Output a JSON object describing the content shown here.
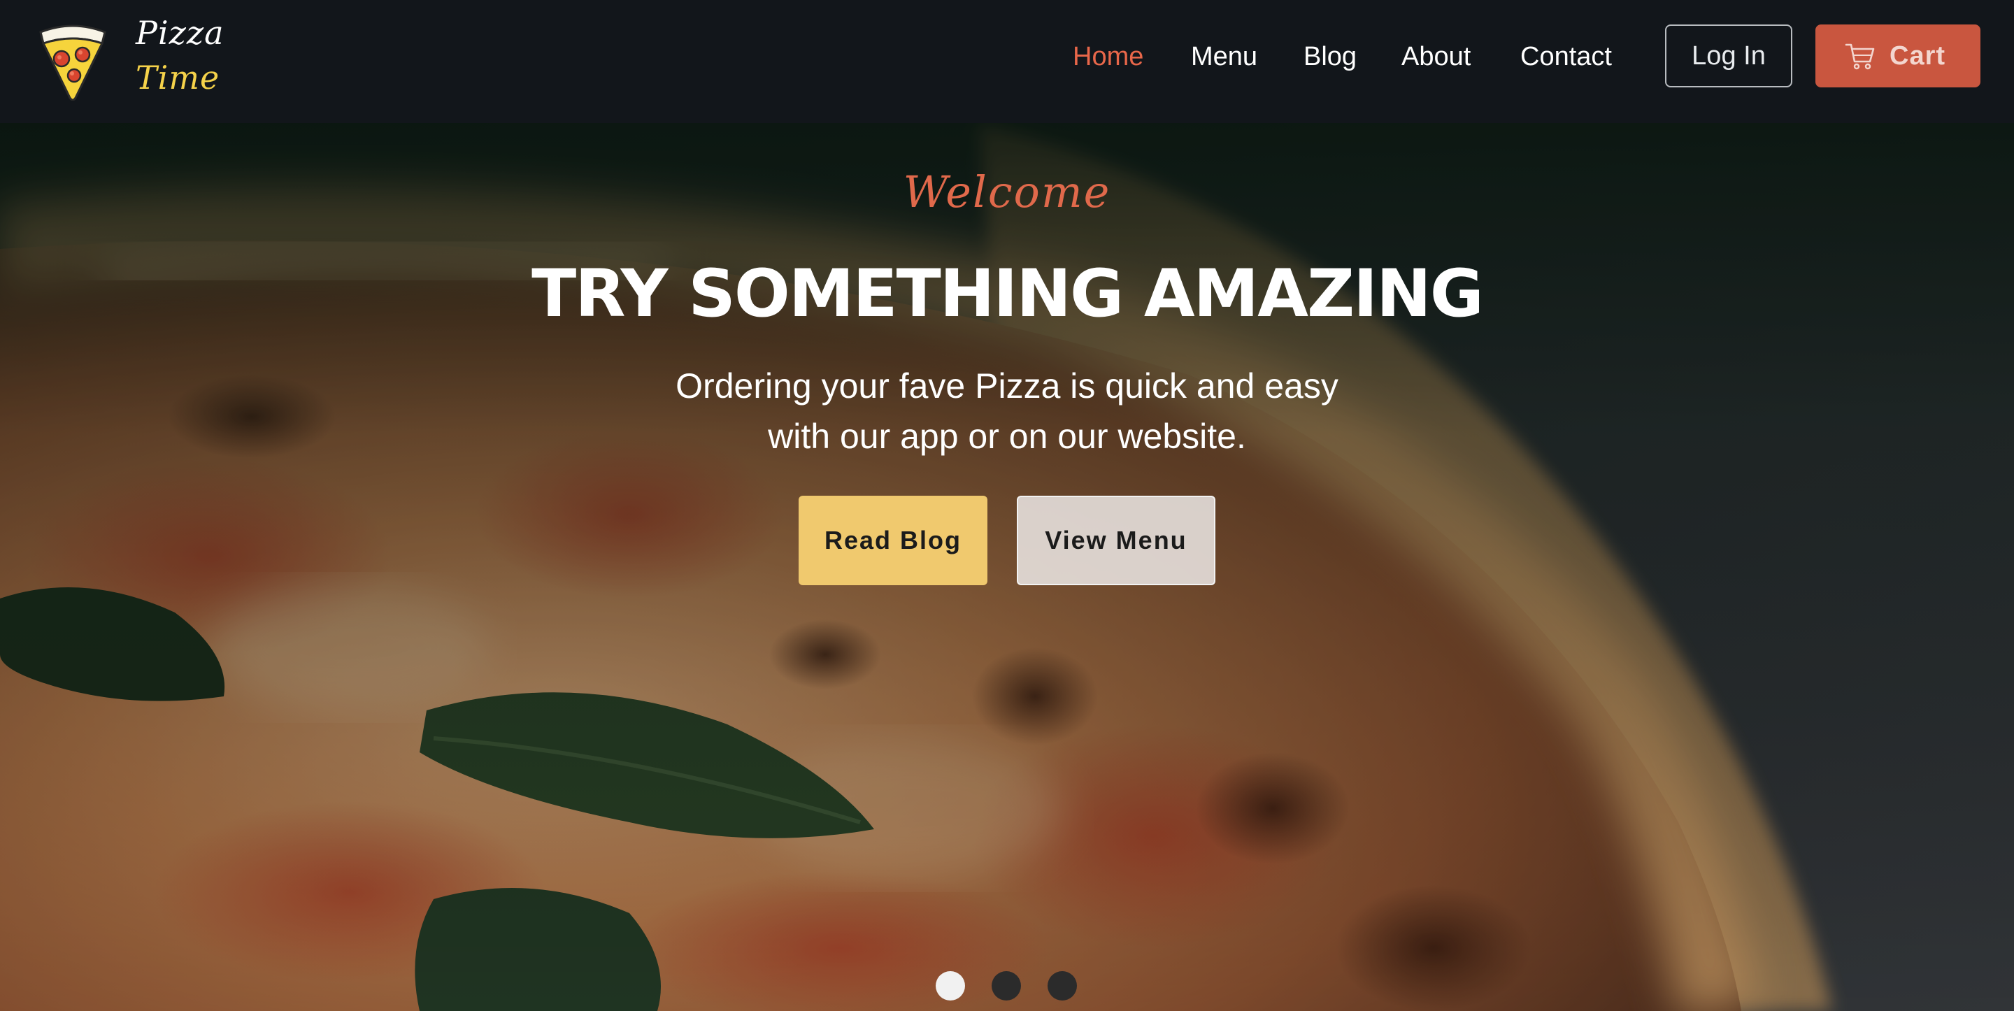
{
  "brand": {
    "line1": "Pizza",
    "line2": "Time",
    "logo_icon": "pizza-slice-icon"
  },
  "nav": {
    "items": [
      {
        "label": "Home",
        "active": true
      },
      {
        "label": "Menu",
        "active": false
      },
      {
        "label": "Blog",
        "active": false
      },
      {
        "label": "About",
        "active": false
      },
      {
        "label": "Contact",
        "active": false
      }
    ],
    "login_label": "Log In",
    "cart_label": "Cart",
    "cart_icon": "shopping-cart-icon"
  },
  "hero": {
    "eyebrow": "Welcome",
    "headline": "TRY SOMETHING AMAZING",
    "subtitle_line1": "Ordering your fave Pizza is quick and easy",
    "subtitle_line2": "with our app or on our website.",
    "primary_button": "Read Blog",
    "secondary_button": "View Menu",
    "background_image": "pizza-closeup-image"
  },
  "carousel": {
    "slide_count": 3,
    "active_slide": 1
  },
  "colors": {
    "header_bg": "#12161b",
    "accent": "#e8674a",
    "cart_bg": "#c9563f",
    "brand_yellow": "#f5d24a",
    "primary_button_bg": "#f0c96e",
    "secondary_button_bg": "#ece8e5"
  }
}
